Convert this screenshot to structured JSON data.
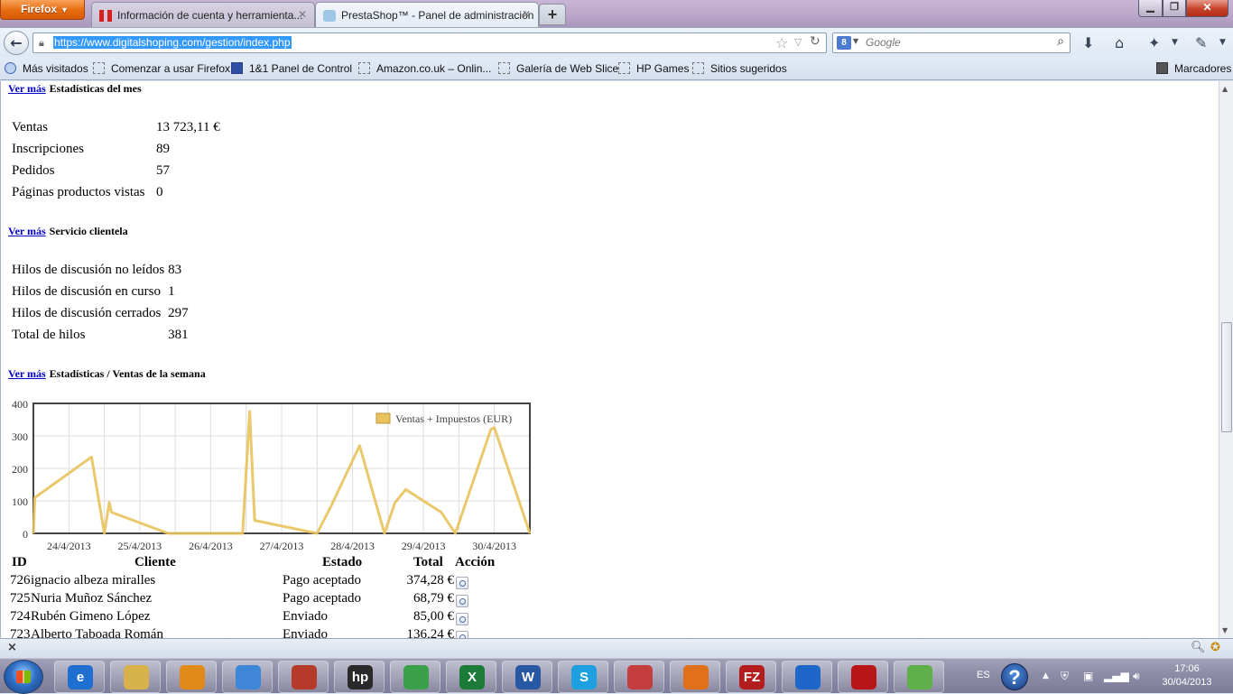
{
  "browser": {
    "menu_label": "Firefox",
    "tabs": [
      {
        "label": "Información de cuenta y herramienta...",
        "active": false
      },
      {
        "label": "PrestaShop™ - Panel de administración",
        "active": true
      }
    ],
    "new_tab": "+",
    "url": "https://www.digitalshoping.com/gestion/index.php",
    "search_placeholder": "Google",
    "search_engine": "8",
    "bookmarks": [
      "Más visitados",
      "Comenzar a usar Firefox",
      "1&1 Panel de Control",
      "Amazon.co.uk – Onlin...",
      "Galería de Web Slice",
      "HP Games",
      "Sitios sugeridos"
    ],
    "bookmarks_menu": "Marcadores"
  },
  "page": {
    "month": {
      "link": "Ver más",
      "title": "Estadísticas del mes",
      "rows": [
        {
          "label": "Ventas",
          "value": "13 723,11 €"
        },
        {
          "label": "Inscripciones",
          "value": "89"
        },
        {
          "label": "Pedidos",
          "value": "57"
        },
        {
          "label": "Páginas productos vistas",
          "value": "0"
        }
      ]
    },
    "service": {
      "link": "Ver más",
      "title": "Servicio clientela",
      "rows": [
        {
          "label": "Hilos de discusión no leídos",
          "value": "83"
        },
        {
          "label": "Hilos de discusión en curso",
          "value": "1"
        },
        {
          "label": "Hilos de discusión cerrados",
          "value": "297"
        },
        {
          "label": "Total de hilos",
          "value": "381"
        }
      ]
    },
    "week": {
      "link": "Ver más",
      "title": "Estadísticas / Ventas de la semana"
    },
    "orders": {
      "headers": {
        "id": "ID",
        "client": "Cliente",
        "status": "Estado",
        "total": "Total",
        "action": "Acción"
      },
      "rows": [
        {
          "id": "726",
          "client": "ignacio albeza miralles",
          "status": "Pago aceptado",
          "total": "374,28 €"
        },
        {
          "id": "725",
          "client": "Nuria Muñoz Sánchez",
          "status": "Pago aceptado",
          "total": "68,79 €"
        },
        {
          "id": "724",
          "client": "Rubén Gimeno López",
          "status": "Enviado",
          "total": "85,00 €"
        },
        {
          "id": "723",
          "client": "Alberto Taboada Román",
          "status": "Enviado",
          "total": "136,24 €"
        }
      ]
    }
  },
  "chart_data": {
    "type": "line",
    "title": "",
    "xlabel": "",
    "ylabel": "",
    "ylim": [
      0,
      400
    ],
    "xlim": [
      0,
      7
    ],
    "yticks": [
      0,
      100,
      200,
      300,
      400
    ],
    "xticks": [
      "24/4/2013",
      "25/4/2013",
      "26/4/2013",
      "27/4/2013",
      "28/4/2013",
      "29/4/2013",
      "30/4/2013"
    ],
    "grid": true,
    "legend": "top-right",
    "color": "#e8c25c",
    "series": [
      {
        "name": "Ventas + Impuestos (EUR)",
        "x": [
          0,
          0.02,
          0.82,
          1.0,
          1.07,
          1.1,
          1.9,
          2.95,
          3.05,
          3.12,
          4.0,
          4.2,
          4.6,
          4.95,
          5.1,
          5.25,
          5.75,
          5.95,
          6.45,
          6.5,
          7.0
        ],
        "y": [
          0,
          110,
          235,
          0,
          95,
          65,
          0,
          0,
          375,
          40,
          0,
          85,
          270,
          0,
          95,
          135,
          65,
          0,
          320,
          325,
          0
        ]
      }
    ]
  },
  "findbar": {
    "close": "×"
  },
  "taskbar": {
    "language": "ES",
    "help": "?",
    "time": "17:06",
    "date": "30/04/2013",
    "apps": [
      "e",
      "",
      "",
      "",
      "",
      "hp",
      "",
      "X",
      "W",
      "S",
      "",
      "",
      "FZ",
      "",
      "",
      ""
    ]
  }
}
